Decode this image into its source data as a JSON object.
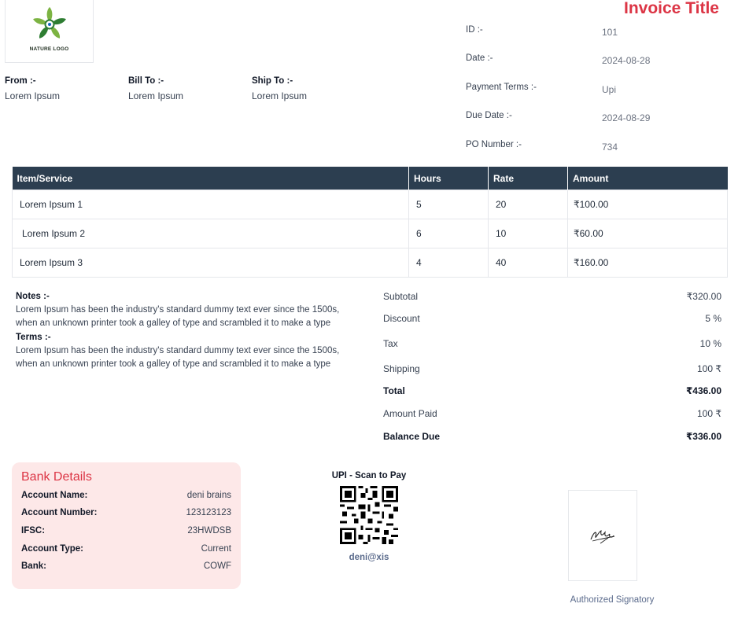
{
  "header": {
    "logo_text": "NATURE LOGO",
    "title": "Invoice Title",
    "title_color": "#dc3545"
  },
  "meta": [
    {
      "label": "ID :-",
      "value": "101"
    },
    {
      "label": "Date :-",
      "value": "2024-08-28"
    },
    {
      "label": "Payment Terms :-",
      "value": "Upi"
    },
    {
      "label": "Due Date :-",
      "value": "2024-08-29"
    },
    {
      "label": "PO Number :-",
      "value": "734"
    }
  ],
  "parties": {
    "from": {
      "label": "From :-",
      "value": "Lorem Ipsum"
    },
    "bill_to": {
      "label": "Bill To :-",
      "value": "Lorem Ipsum"
    },
    "ship_to": {
      "label": "Ship To :-",
      "value": "Lorem Ipsum"
    }
  },
  "table": {
    "header_color": "#2c3e50",
    "columns": [
      "Item/Service",
      "Hours",
      "Rate",
      "Amount"
    ],
    "rows": [
      [
        "Lorem Ipsum 1",
        "5",
        "20",
        "₹100.00"
      ],
      [
        "Lorem Ipsum 2",
        "6",
        "10",
        "₹60.00"
      ],
      [
        "Lorem Ipsum 3",
        "4",
        "40",
        "₹160.00"
      ]
    ]
  },
  "notes": {
    "notes_label": "Notes :-",
    "notes_text": "Lorem Ipsum has been the industry's standard dummy text ever since the 1500s, when an unknown printer took a galley of type and scrambled it to make a type",
    "terms_label": "Terms :-",
    "terms_text": "Lorem Ipsum has been the industry's standard dummy text ever since the 1500s, when an unknown printer took a galley of type and scrambled it to make a type"
  },
  "summary": [
    {
      "label": "Subtotal",
      "value": "₹320.00",
      "bold": false
    },
    {
      "label": "Discount",
      "value": "5 %",
      "bold": false
    },
    {
      "label": "Tax",
      "value": "10 %",
      "bold": false
    },
    {
      "label": "Shipping",
      "value": "100 ₹",
      "bold": false
    },
    {
      "label": "Total",
      "value": "₹436.00",
      "bold": true
    },
    {
      "label": "Amount Paid",
      "value": "100 ₹",
      "bold": false
    },
    {
      "label": "Balance Due",
      "value": "₹336.00",
      "bold": true
    }
  ],
  "bank": {
    "title": "Bank Details",
    "background": "#fde8e8",
    "rows": [
      {
        "label": "Account Name:",
        "value": "deni brains"
      },
      {
        "label": "Account Number:",
        "value": "123123123"
      },
      {
        "label": "IFSC:",
        "value": "23HWDSB"
      },
      {
        "label": "Account Type:",
        "value": "Current"
      },
      {
        "label": "Bank:",
        "value": "COWF"
      }
    ]
  },
  "upi": {
    "title": "UPI - Scan to Pay",
    "id": "deni@xis",
    "icon": "qr-code-icon"
  },
  "signature": {
    "label": "Authorized Signatory"
  }
}
